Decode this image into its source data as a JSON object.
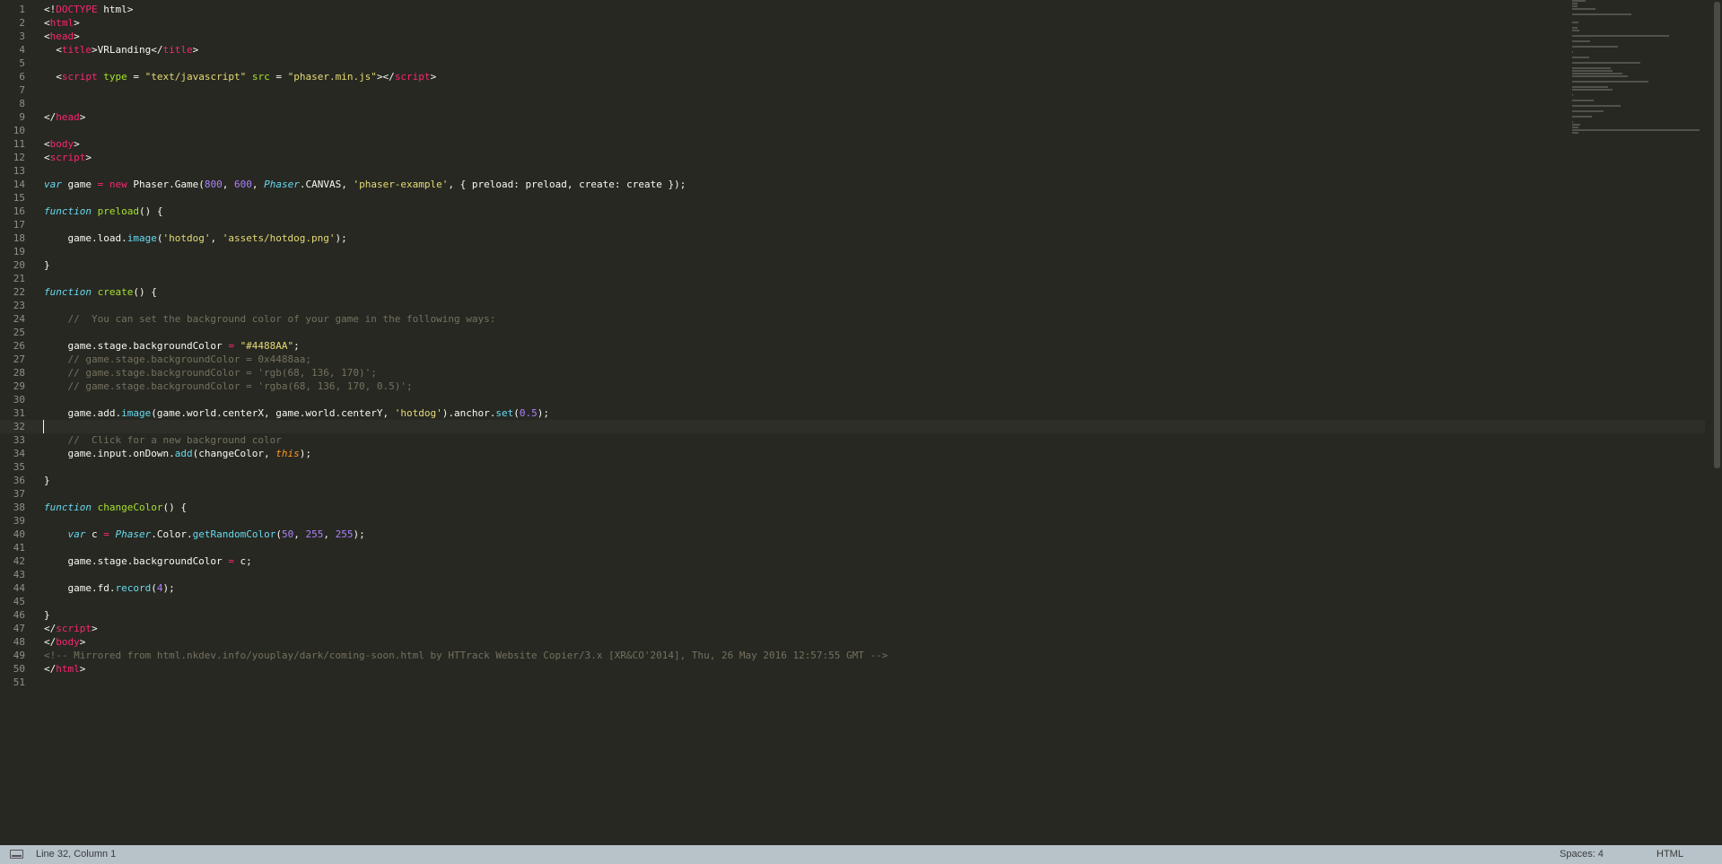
{
  "editor": {
    "current_line": 32,
    "lines": [
      [
        [
          "tag-bracket",
          "<!"
        ],
        [
          "tag",
          "DOCTYPE"
        ],
        [
          "plain",
          " html>"
        ]
      ],
      [
        [
          "plain",
          "<"
        ],
        [
          "tag",
          "html"
        ],
        [
          "plain",
          ">"
        ]
      ],
      [
        [
          "plain",
          "<"
        ],
        [
          "tag",
          "head"
        ],
        [
          "plain",
          ">"
        ]
      ],
      [
        [
          "plain",
          "  <"
        ],
        [
          "tag",
          "title"
        ],
        [
          "plain",
          ">VRLanding</"
        ],
        [
          "tag",
          "title"
        ],
        [
          "plain",
          ">"
        ]
      ],
      [],
      [
        [
          "plain",
          "  <"
        ],
        [
          "tag",
          "script"
        ],
        [
          "plain",
          " "
        ],
        [
          "attr",
          "type"
        ],
        [
          "plain",
          " = "
        ],
        [
          "str",
          "\"text/javascript\""
        ],
        [
          "plain",
          " "
        ],
        [
          "attr",
          "src"
        ],
        [
          "plain",
          " = "
        ],
        [
          "str",
          "\"phaser.min.js\""
        ],
        [
          "plain",
          "></"
        ],
        [
          "tag",
          "script"
        ],
        [
          "plain",
          ">"
        ]
      ],
      [],
      [],
      [
        [
          "plain",
          "</"
        ],
        [
          "tag",
          "head"
        ],
        [
          "plain",
          ">"
        ]
      ],
      [],
      [
        [
          "plain",
          "<"
        ],
        [
          "tag",
          "body"
        ],
        [
          "plain",
          ">"
        ]
      ],
      [
        [
          "plain",
          "<"
        ],
        [
          "tag",
          "script"
        ],
        [
          "plain",
          ">"
        ]
      ],
      [],
      [
        [
          "type",
          "var"
        ],
        [
          "plain",
          " game "
        ],
        [
          "kw",
          "="
        ],
        [
          "plain",
          " "
        ],
        [
          "kw",
          "new"
        ],
        [
          "plain",
          " Phaser.Game("
        ],
        [
          "num",
          "800"
        ],
        [
          "plain",
          ", "
        ],
        [
          "num",
          "600"
        ],
        [
          "plain",
          ", "
        ],
        [
          "type",
          "Phaser"
        ],
        [
          "plain",
          ".CANVAS, "
        ],
        [
          "str",
          "'phaser-example'"
        ],
        [
          "plain",
          ", { preload: preload, create: create });"
        ]
      ],
      [],
      [
        [
          "type",
          "function"
        ],
        [
          "plain",
          " "
        ],
        [
          "fn",
          "preload"
        ],
        [
          "plain",
          "() {"
        ]
      ],
      [],
      [
        [
          "plain",
          "    game.load."
        ],
        [
          "call",
          "image"
        ],
        [
          "plain",
          "("
        ],
        [
          "str",
          "'hotdog'"
        ],
        [
          "plain",
          ", "
        ],
        [
          "str",
          "'assets/hotdog.png'"
        ],
        [
          "plain",
          ");"
        ]
      ],
      [],
      [
        [
          "plain",
          "}"
        ]
      ],
      [],
      [
        [
          "type",
          "function"
        ],
        [
          "plain",
          " "
        ],
        [
          "fn",
          "create"
        ],
        [
          "plain",
          "() {"
        ]
      ],
      [],
      [
        [
          "cm",
          "    //  You can set the background color of your game in the following ways:"
        ]
      ],
      [],
      [
        [
          "plain",
          "    game.stage.backgroundColor "
        ],
        [
          "kw",
          "="
        ],
        [
          "plain",
          " "
        ],
        [
          "str",
          "\"#4488AA\""
        ],
        [
          "plain",
          ";"
        ]
      ],
      [
        [
          "cm",
          "    // game.stage.backgroundColor = 0x4488aa;"
        ]
      ],
      [
        [
          "cm",
          "    // game.stage.backgroundColor = 'rgb(68, 136, 170)';"
        ]
      ],
      [
        [
          "cm",
          "    // game.stage.backgroundColor = 'rgba(68, 136, 170, 0.5)';"
        ]
      ],
      [],
      [
        [
          "plain",
          "    game.add."
        ],
        [
          "call",
          "image"
        ],
        [
          "plain",
          "(game.world.centerX, game.world.centerY, "
        ],
        [
          "str",
          "'hotdog'"
        ],
        [
          "plain",
          ").anchor."
        ],
        [
          "call",
          "set"
        ],
        [
          "plain",
          "("
        ],
        [
          "num",
          "0.5"
        ],
        [
          "plain",
          ");"
        ]
      ],
      [],
      [
        [
          "cm",
          "    //  Click for a new background color"
        ]
      ],
      [
        [
          "plain",
          "    game.input.onDown."
        ],
        [
          "call",
          "add"
        ],
        [
          "plain",
          "(changeColor, "
        ],
        [
          "this",
          "this"
        ],
        [
          "plain",
          ");"
        ]
      ],
      [],
      [
        [
          "plain",
          "}"
        ]
      ],
      [],
      [
        [
          "type",
          "function"
        ],
        [
          "plain",
          " "
        ],
        [
          "fn",
          "changeColor"
        ],
        [
          "plain",
          "() {"
        ]
      ],
      [],
      [
        [
          "plain",
          "    "
        ],
        [
          "type",
          "var"
        ],
        [
          "plain",
          " c "
        ],
        [
          "kw",
          "="
        ],
        [
          "plain",
          " "
        ],
        [
          "type",
          "Phaser"
        ],
        [
          "plain",
          ".Color."
        ],
        [
          "call",
          "getRandomColor"
        ],
        [
          "plain",
          "("
        ],
        [
          "num",
          "50"
        ],
        [
          "plain",
          ", "
        ],
        [
          "num",
          "255"
        ],
        [
          "plain",
          ", "
        ],
        [
          "num",
          "255"
        ],
        [
          "plain",
          ");"
        ]
      ],
      [],
      [
        [
          "plain",
          "    game.stage.backgroundColor "
        ],
        [
          "kw",
          "="
        ],
        [
          "plain",
          " c;"
        ]
      ],
      [],
      [
        [
          "plain",
          "    game.fd."
        ],
        [
          "call",
          "record"
        ],
        [
          "plain",
          "("
        ],
        [
          "num",
          "4"
        ],
        [
          "plain",
          ");"
        ]
      ],
      [],
      [
        [
          "plain",
          "}"
        ]
      ],
      [
        [
          "plain",
          "</"
        ],
        [
          "tag",
          "script"
        ],
        [
          "plain",
          ">"
        ]
      ],
      [
        [
          "plain",
          "</"
        ],
        [
          "tag",
          "body"
        ],
        [
          "plain",
          ">"
        ]
      ],
      [
        [
          "cm",
          "<!-- Mirrored from html.nkdev.info/youplay/dark/coming-soon.html by HTTrack Website Copier/3.x [XR&CO'2014], Thu, 26 May 2016 12:57:55 GMT -->"
        ]
      ],
      [
        [
          "plain",
          "</"
        ],
        [
          "tag",
          "html"
        ],
        [
          "plain",
          ">"
        ]
      ],
      []
    ]
  },
  "colors": {
    "background": "#272822",
    "statusbar": "#b7c2c9"
  },
  "statusbar": {
    "panel_icon": "panel-toggle-icon",
    "position": "Line 32, Column 1",
    "indentation": "Spaces: 4",
    "syntax": "HTML"
  }
}
